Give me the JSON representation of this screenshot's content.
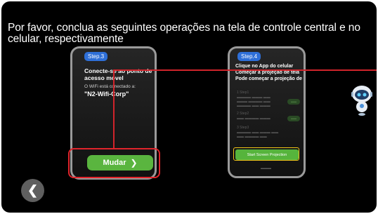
{
  "instruction": "Por favor, conclua as seguintes operações na tela de controle central e no celular, respectivamente",
  "left_phone": {
    "step": "Step.3",
    "title": "Conecte-se ao ponto de acesso móvel",
    "connected_label": "O WiFi está conectado a:",
    "wifi_name": "\"N2-Wifi-Corp\"",
    "button_label": "Mudar"
  },
  "right_phone": {
    "step": "Step.4",
    "title": "Clique no App do celular",
    "line2": "Começar a projeção de tela",
    "line3": "Pode começar a projeção de te",
    "steps": [
      {
        "num": "1",
        "name": "Step1"
      },
      {
        "num": "2",
        "name": "Step2"
      },
      {
        "num": "3",
        "name": "Step3"
      }
    ],
    "projection_button": "Start Screen Projection"
  },
  "colors": {
    "accent_green": "#5ab53f",
    "highlight_red": "#e0242b",
    "highlight_yellow": "#f0c419",
    "step_blue": "#2e6fd8"
  },
  "icons": {
    "back": "chevron-left-icon",
    "assistant": "robot-icon",
    "button_arrow": "chevron-right-icon"
  }
}
